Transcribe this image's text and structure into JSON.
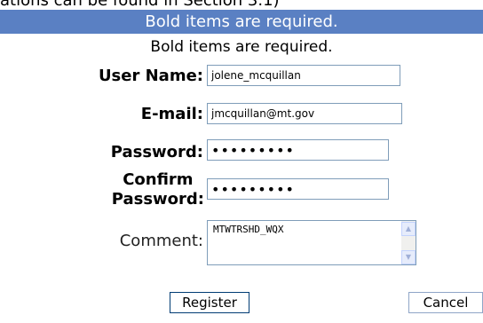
{
  "top_partial_text": "ations can be found in Section 3.1)",
  "header": {
    "title": "Bold items are required."
  },
  "form": {
    "note": "Bold items are required.",
    "username": {
      "label": "User Name:",
      "value": "jolene_mcquillan"
    },
    "email": {
      "label": "E-mail:",
      "value": "jmcquillan@mt.gov"
    },
    "password": {
      "label": "Password:",
      "value": "•••••••••"
    },
    "confirm_password": {
      "label_line1": "Confirm",
      "label_line2": "Password:",
      "value": "•••••••••"
    },
    "comment": {
      "label": "Comment:",
      "value": "MTWTRSHD_WQX"
    }
  },
  "buttons": {
    "register": "Register",
    "cancel": "Cancel"
  },
  "icons": {
    "scroll_up": "scroll-up-arrow-icon",
    "scroll_down": "scroll-down-arrow-icon"
  },
  "colors": {
    "header_bg": "#5a80c3",
    "header_text": "#ffffff",
    "field_border": "#7f9db9"
  }
}
